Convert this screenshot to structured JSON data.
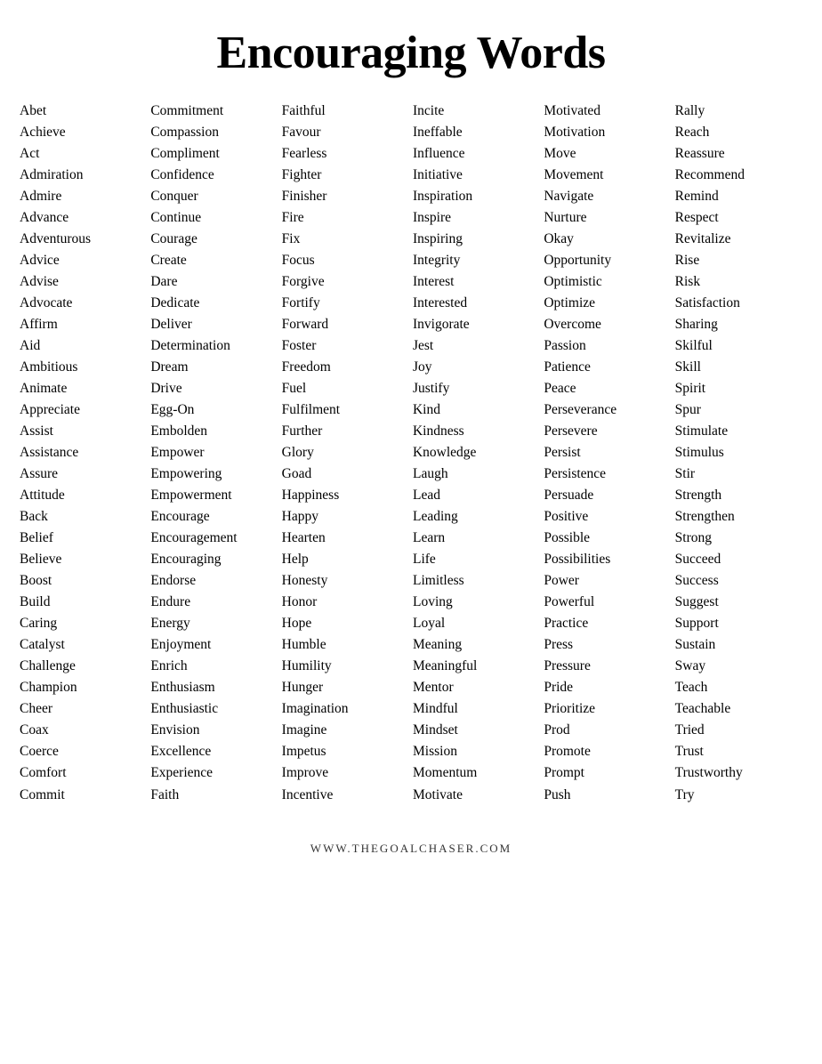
{
  "title": "Encouraging Words",
  "footer": "WWW.THEGOALCHASER.COM",
  "columns": [
    {
      "id": "col1",
      "words": [
        "Abet",
        "Achieve",
        "Act",
        "Admiration",
        "Admire",
        "Advance",
        "Adventurous",
        "Advice",
        "Advise",
        "Advocate",
        "Affirm",
        "Aid",
        "Ambitious",
        "Animate",
        "Appreciate",
        "Assist",
        "Assistance",
        "Assure",
        "Attitude",
        "Back",
        "Belief",
        "Believe",
        "Boost",
        "Build",
        "Caring",
        "Catalyst",
        "Challenge",
        "Champion",
        "Cheer",
        "Coax",
        "Coerce",
        "Comfort",
        "Commit"
      ]
    },
    {
      "id": "col2",
      "words": [
        "Commitment",
        "Compassion",
        "Compliment",
        "Confidence",
        "Conquer",
        "Continue",
        "Courage",
        "Create",
        "Dare",
        "Dedicate",
        "Deliver",
        "Determination",
        "Dream",
        "Drive",
        "Egg-On",
        "Embolden",
        "Empower",
        "Empowering",
        "Empowerment",
        "Encourage",
        "Encouragement",
        "Encouraging",
        "Endorse",
        "Endure",
        "Energy",
        "Enjoyment",
        "Enrich",
        "Enthusiasm",
        "Enthusiastic",
        "Envision",
        "Excellence",
        "Experience",
        "Faith"
      ]
    },
    {
      "id": "col3",
      "words": [
        "Faithful",
        "Favour",
        "Fearless",
        "Fighter",
        "Finisher",
        "Fire",
        "Fix",
        "Focus",
        "Forgive",
        "Fortify",
        "Forward",
        "Foster",
        "Freedom",
        "Fuel",
        "Fulfilment",
        "Further",
        "Glory",
        "Goad",
        "Happiness",
        "Happy",
        "Hearten",
        "Help",
        "Honesty",
        "Honor",
        "Hope",
        "Humble",
        "Humility",
        "Hunger",
        "Imagination",
        "Imagine",
        "Impetus",
        "Improve",
        "Incentive"
      ]
    },
    {
      "id": "col4",
      "words": [
        "Incite",
        "Ineffable",
        "Influence",
        "Initiative",
        "Inspiration",
        "Inspire",
        "Inspiring",
        "Integrity",
        "Interest",
        "Interested",
        "Invigorate",
        "Jest",
        "Joy",
        "Justify",
        "Kind",
        "Kindness",
        "Knowledge",
        "Laugh",
        "Lead",
        "Leading",
        "Learn",
        "Life",
        "Limitless",
        "Loving",
        "Loyal",
        "Meaning",
        "Meaningful",
        "Mentor",
        "Mindful",
        "Mindset",
        "Mission",
        "Momentum",
        "Motivate"
      ]
    },
    {
      "id": "col5",
      "words": [
        "Motivated",
        "Motivation",
        "Move",
        "Movement",
        "Navigate",
        "Nurture",
        "Okay",
        "Opportunity",
        "Optimistic",
        "Optimize",
        "Overcome",
        "Passion",
        "Patience",
        "Peace",
        "Perseverance",
        "Persevere",
        "Persist",
        "Persistence",
        "Persuade",
        "Positive",
        "Possible",
        "Possibilities",
        "Power",
        "Powerful",
        "Practice",
        "Press",
        "Pressure",
        "Pride",
        "Prioritize",
        "Prod",
        "Promote",
        "Prompt",
        "Push"
      ]
    },
    {
      "id": "col6",
      "words": [
        "Rally",
        "Reach",
        "Reassure",
        "Recommend",
        "Remind",
        "Respect",
        "Revitalize",
        "Rise",
        "Risk",
        "Satisfaction",
        "Sharing",
        "Skilful",
        "Skill",
        "Spirit",
        "Spur",
        "Stimulate",
        "Stimulus",
        "Stir",
        "Strength",
        "Strengthen",
        "Strong",
        "Succeed",
        "Success",
        "Suggest",
        "Support",
        "Sustain",
        "Sway",
        "Teach",
        "Teachable",
        "Tried",
        "Trust",
        "Trustworthy",
        "Try"
      ]
    }
  ]
}
